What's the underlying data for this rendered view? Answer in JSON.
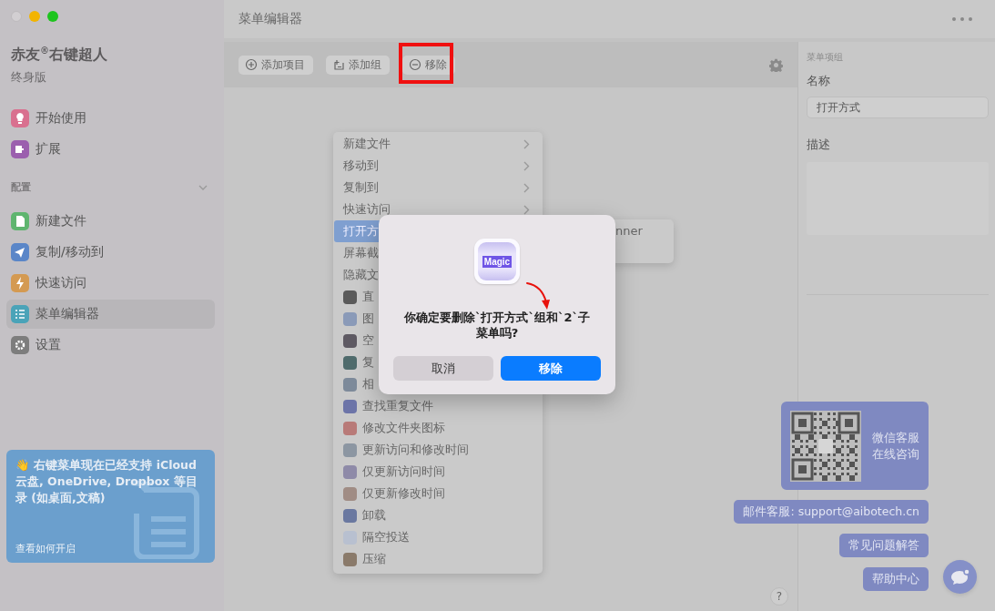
{
  "sidebar": {
    "app_name": "赤友$^{®}$右键超人",
    "edition": "终身版",
    "items": [
      {
        "label": "开始使用",
        "color": "#d9708f",
        "selected": false
      },
      {
        "label": "扩展",
        "color": "#9b5fae",
        "selected": false
      }
    ],
    "section": {
      "label": "配置",
      "expanded": true,
      "items": [
        {
          "label": "新建文件",
          "color": "#5fb56f",
          "selected": false
        },
        {
          "label": "复制/移动到",
          "color": "#5a86c8",
          "selected": false
        },
        {
          "label": "快速访问",
          "color": "#d49a52",
          "selected": false
        },
        {
          "label": "菜单编辑器",
          "color": "#4aa3b8",
          "selected": true
        },
        {
          "label": "设置",
          "color": "#7d7d7d",
          "selected": false
        }
      ]
    },
    "promo": {
      "text": "👋 右键菜单现在已经支持 iCloud 云盘, OneDrive, Dropbox 等目录 (如桌面,文稿)",
      "link": "查看如何开启"
    }
  },
  "main": {
    "title": "菜单编辑器",
    "toolbar": [
      {
        "label": "添加项目",
        "annotated": false
      },
      {
        "label": "添加组",
        "annotated": false
      },
      {
        "label": "移除",
        "annotated": true
      }
    ],
    "context_menu": [
      {
        "label": "新建文件",
        "kind": "text",
        "submenu": true,
        "selected": false
      },
      {
        "label": "移动到",
        "kind": "text",
        "submenu": true,
        "selected": false
      },
      {
        "label": "复制到",
        "kind": "text",
        "submenu": true,
        "selected": false
      },
      {
        "label": "快速访问",
        "kind": "text",
        "submenu": true,
        "selected": false
      },
      {
        "label": "打开方",
        "kind": "text",
        "submenu": false,
        "selected": true
      },
      {
        "label": "屏幕截",
        "kind": "text",
        "submenu": false,
        "selected": false
      },
      {
        "label": "隐藏文",
        "kind": "text",
        "submenu": false,
        "selected": false
      },
      {
        "label": "直",
        "kind": "icon",
        "color": "#5a5a5a",
        "submenu": false,
        "selected": false
      },
      {
        "label": "图",
        "kind": "icon",
        "color": "#8a9ab8",
        "submenu": false,
        "selected": false
      },
      {
        "label": "空",
        "kind": "icon",
        "color": "#5e5a63",
        "submenu": false,
        "selected": false
      },
      {
        "label": "复",
        "kind": "icon",
        "color": "#4f6b6c",
        "submenu": false,
        "selected": false
      },
      {
        "label": "相",
        "kind": "icon",
        "color": "#7d8a9a",
        "submenu": false,
        "selected": false
      },
      {
        "label": "查找重复文件",
        "kind": "icon",
        "color": "#6c74a8",
        "submenu": false,
        "selected": false
      },
      {
        "label": "修改文件夹图标",
        "kind": "icon",
        "color": "#b87a78",
        "submenu": false,
        "selected": false
      },
      {
        "label": "更新访问和修改时间",
        "kind": "icon",
        "color": "#8c96a2",
        "submenu": false,
        "selected": false
      },
      {
        "label": "仅更新访问时间",
        "kind": "icon",
        "color": "#8e8aa8",
        "submenu": false,
        "selected": false
      },
      {
        "label": "仅更新修改时间",
        "kind": "icon",
        "color": "#a08c84",
        "submenu": false,
        "selected": false
      },
      {
        "label": "卸载",
        "kind": "icon",
        "color": "#6a78a0",
        "submenu": false,
        "selected": false
      },
      {
        "label": "隔空投送",
        "kind": "icon",
        "color": "#b8c0d0",
        "submenu": false,
        "selected": false
      },
      {
        "label": "压缩",
        "kind": "icon",
        "color": "#8a7a6a",
        "submenu": false,
        "selected": false
      }
    ],
    "submenu": [
      "nner"
    ],
    "help": "?"
  },
  "inspector": {
    "section": "菜单项组",
    "name_label": "名称",
    "name_value": "打开方式",
    "description_label": "描述"
  },
  "support": {
    "qr_text": [
      "微信客服",
      "在线咨询"
    ],
    "email": "邮件客服: support@aibotech.cn",
    "faq": "常见问题解答",
    "help_center": "帮助中心"
  },
  "dialog": {
    "icon_text": "Magic",
    "message": "你确定要删除`打开方式`组和`2`子菜单吗?",
    "buttons": [
      {
        "label": "取消",
        "default": false
      },
      {
        "label": "移除",
        "default": true
      }
    ]
  }
}
